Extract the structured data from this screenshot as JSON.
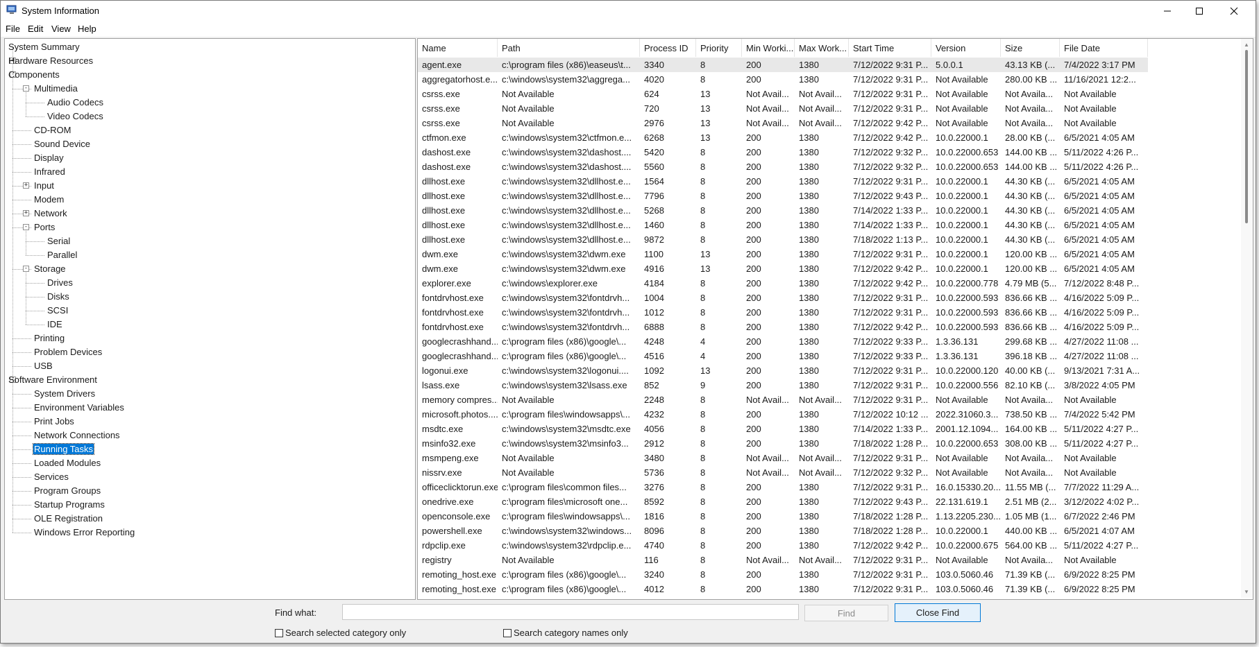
{
  "window": {
    "title": "System Information"
  },
  "menu": [
    "File",
    "Edit",
    "View",
    "Help"
  ],
  "tree": [
    {
      "label": "System Summary",
      "level": 0,
      "expander": ""
    },
    {
      "label": "Hardware Resources",
      "level": 0,
      "expander": "+"
    },
    {
      "label": "Components",
      "level": 0,
      "expander": "-"
    },
    {
      "label": "Multimedia",
      "level": 1,
      "expander": "-"
    },
    {
      "label": "Audio Codecs",
      "level": 2,
      "expander": ""
    },
    {
      "label": "Video Codecs",
      "level": 2,
      "expander": ""
    },
    {
      "label": "CD-ROM",
      "level": 1,
      "expander": ""
    },
    {
      "label": "Sound Device",
      "level": 1,
      "expander": ""
    },
    {
      "label": "Display",
      "level": 1,
      "expander": ""
    },
    {
      "label": "Infrared",
      "level": 1,
      "expander": ""
    },
    {
      "label": "Input",
      "level": 1,
      "expander": "+"
    },
    {
      "label": "Modem",
      "level": 1,
      "expander": ""
    },
    {
      "label": "Network",
      "level": 1,
      "expander": "+"
    },
    {
      "label": "Ports",
      "level": 1,
      "expander": "-"
    },
    {
      "label": "Serial",
      "level": 2,
      "expander": ""
    },
    {
      "label": "Parallel",
      "level": 2,
      "expander": ""
    },
    {
      "label": "Storage",
      "level": 1,
      "expander": "-"
    },
    {
      "label": "Drives",
      "level": 2,
      "expander": ""
    },
    {
      "label": "Disks",
      "level": 2,
      "expander": ""
    },
    {
      "label": "SCSI",
      "level": 2,
      "expander": ""
    },
    {
      "label": "IDE",
      "level": 2,
      "expander": ""
    },
    {
      "label": "Printing",
      "level": 1,
      "expander": ""
    },
    {
      "label": "Problem Devices",
      "level": 1,
      "expander": ""
    },
    {
      "label": "USB",
      "level": 1,
      "expander": ""
    },
    {
      "label": "Software Environment",
      "level": 0,
      "expander": "-"
    },
    {
      "label": "System Drivers",
      "level": 1,
      "expander": ""
    },
    {
      "label": "Environment Variables",
      "level": 1,
      "expander": ""
    },
    {
      "label": "Print Jobs",
      "level": 1,
      "expander": ""
    },
    {
      "label": "Network Connections",
      "level": 1,
      "expander": ""
    },
    {
      "label": "Running Tasks",
      "level": 1,
      "expander": "",
      "selected": true
    },
    {
      "label": "Loaded Modules",
      "level": 1,
      "expander": ""
    },
    {
      "label": "Services",
      "level": 1,
      "expander": ""
    },
    {
      "label": "Program Groups",
      "level": 1,
      "expander": ""
    },
    {
      "label": "Startup Programs",
      "level": 1,
      "expander": ""
    },
    {
      "label": "OLE Registration",
      "level": 1,
      "expander": ""
    },
    {
      "label": "Windows Error Reporting",
      "level": 1,
      "expander": ""
    }
  ],
  "columns": [
    "Name",
    "Path",
    "Process ID",
    "Priority",
    "Min Worki...",
    "Max Work...",
    "Start Time",
    "Version",
    "Size",
    "File Date"
  ],
  "rows": [
    [
      "agent.exe",
      "c:\\program files (x86)\\easeus\\t...",
      "3340",
      "8",
      "200",
      "1380",
      "7/12/2022 9:31 P...",
      "5.0.0.1",
      "43.13 KB (...",
      "7/4/2022 3:17 PM"
    ],
    [
      "aggregatorhost.e...",
      "c:\\windows\\system32\\aggrega...",
      "4020",
      "8",
      "200",
      "1380",
      "7/12/2022 9:31 P...",
      "Not Available",
      "280.00 KB ...",
      "11/16/2021 12:2..."
    ],
    [
      "csrss.exe",
      "Not Available",
      "624",
      "13",
      "Not Avail...",
      "Not Avail...",
      "7/12/2022 9:31 P...",
      "Not Available",
      "Not Availa...",
      "Not Available"
    ],
    [
      "csrss.exe",
      "Not Available",
      "720",
      "13",
      "Not Avail...",
      "Not Avail...",
      "7/12/2022 9:31 P...",
      "Not Available",
      "Not Availa...",
      "Not Available"
    ],
    [
      "csrss.exe",
      "Not Available",
      "2976",
      "13",
      "Not Avail...",
      "Not Avail...",
      "7/12/2022 9:42 P...",
      "Not Available",
      "Not Availa...",
      "Not Available"
    ],
    [
      "ctfmon.exe",
      "c:\\windows\\system32\\ctfmon.e...",
      "6268",
      "13",
      "200",
      "1380",
      "7/12/2022 9:42 P...",
      "10.0.22000.1",
      "28.00 KB (...",
      "6/5/2021 4:05 AM"
    ],
    [
      "dashost.exe",
      "c:\\windows\\system32\\dashost....",
      "5420",
      "8",
      "200",
      "1380",
      "7/12/2022 9:32 P...",
      "10.0.22000.653",
      "144.00 KB ...",
      "5/11/2022 4:26 P..."
    ],
    [
      "dashost.exe",
      "c:\\windows\\system32\\dashost....",
      "5560",
      "8",
      "200",
      "1380",
      "7/12/2022 9:32 P...",
      "10.0.22000.653",
      "144.00 KB ...",
      "5/11/2022 4:26 P..."
    ],
    [
      "dllhost.exe",
      "c:\\windows\\system32\\dllhost.e...",
      "1564",
      "8",
      "200",
      "1380",
      "7/12/2022 9:31 P...",
      "10.0.22000.1",
      "44.30 KB (...",
      "6/5/2021 4:05 AM"
    ],
    [
      "dllhost.exe",
      "c:\\windows\\system32\\dllhost.e...",
      "7796",
      "8",
      "200",
      "1380",
      "7/12/2022 9:43 P...",
      "10.0.22000.1",
      "44.30 KB (...",
      "6/5/2021 4:05 AM"
    ],
    [
      "dllhost.exe",
      "c:\\windows\\system32\\dllhost.e...",
      "5268",
      "8",
      "200",
      "1380",
      "7/14/2022 1:33 P...",
      "10.0.22000.1",
      "44.30 KB (...",
      "6/5/2021 4:05 AM"
    ],
    [
      "dllhost.exe",
      "c:\\windows\\system32\\dllhost.e...",
      "1460",
      "8",
      "200",
      "1380",
      "7/14/2022 1:33 P...",
      "10.0.22000.1",
      "44.30 KB (...",
      "6/5/2021 4:05 AM"
    ],
    [
      "dllhost.exe",
      "c:\\windows\\system32\\dllhost.e...",
      "9872",
      "8",
      "200",
      "1380",
      "7/18/2022 1:13 P...",
      "10.0.22000.1",
      "44.30 KB (...",
      "6/5/2021 4:05 AM"
    ],
    [
      "dwm.exe",
      "c:\\windows\\system32\\dwm.exe",
      "1100",
      "13",
      "200",
      "1380",
      "7/12/2022 9:31 P...",
      "10.0.22000.1",
      "120.00 KB ...",
      "6/5/2021 4:05 AM"
    ],
    [
      "dwm.exe",
      "c:\\windows\\system32\\dwm.exe",
      "4916",
      "13",
      "200",
      "1380",
      "7/12/2022 9:42 P...",
      "10.0.22000.1",
      "120.00 KB ...",
      "6/5/2021 4:05 AM"
    ],
    [
      "explorer.exe",
      "c:\\windows\\explorer.exe",
      "4184",
      "8",
      "200",
      "1380",
      "7/12/2022 9:42 P...",
      "10.0.22000.778",
      "4.79 MB (5...",
      "7/12/2022 8:48 P..."
    ],
    [
      "fontdrvhost.exe",
      "c:\\windows\\system32\\fontdrvh...",
      "1004",
      "8",
      "200",
      "1380",
      "7/12/2022 9:31 P...",
      "10.0.22000.593",
      "836.66 KB ...",
      "4/16/2022 5:09 P..."
    ],
    [
      "fontdrvhost.exe",
      "c:\\windows\\system32\\fontdrvh...",
      "1012",
      "8",
      "200",
      "1380",
      "7/12/2022 9:31 P...",
      "10.0.22000.593",
      "836.66 KB ...",
      "4/16/2022 5:09 P..."
    ],
    [
      "fontdrvhost.exe",
      "c:\\windows\\system32\\fontdrvh...",
      "6888",
      "8",
      "200",
      "1380",
      "7/12/2022 9:42 P...",
      "10.0.22000.593",
      "836.66 KB ...",
      "4/16/2022 5:09 P..."
    ],
    [
      "googlecrashhand...",
      "c:\\program files (x86)\\google\\...",
      "4248",
      "4",
      "200",
      "1380",
      "7/12/2022 9:33 P...",
      "1.3.36.131",
      "299.68 KB ...",
      "4/27/2022 11:08 ..."
    ],
    [
      "googlecrashhand...",
      "c:\\program files (x86)\\google\\...",
      "4516",
      "4",
      "200",
      "1380",
      "7/12/2022 9:33 P...",
      "1.3.36.131",
      "396.18 KB ...",
      "4/27/2022 11:08 ..."
    ],
    [
      "logonui.exe",
      "c:\\windows\\system32\\logonui....",
      "1092",
      "13",
      "200",
      "1380",
      "7/12/2022 9:31 P...",
      "10.0.22000.120",
      "40.00 KB (...",
      "9/13/2021 7:31 A..."
    ],
    [
      "lsass.exe",
      "c:\\windows\\system32\\lsass.exe",
      "852",
      "9",
      "200",
      "1380",
      "7/12/2022 9:31 P...",
      "10.0.22000.556",
      "82.10 KB (...",
      "3/8/2022 4:05 PM"
    ],
    [
      "memory compres...",
      "Not Available",
      "2248",
      "8",
      "Not Avail...",
      "Not Avail...",
      "7/12/2022 9:31 P...",
      "Not Available",
      "Not Availa...",
      "Not Available"
    ],
    [
      "microsoft.photos....",
      "c:\\program files\\windowsapps\\...",
      "4232",
      "8",
      "200",
      "1380",
      "7/12/2022 10:12 ...",
      "2022.31060.3...",
      "738.50 KB ...",
      "7/4/2022 5:42 PM"
    ],
    [
      "msdtc.exe",
      "c:\\windows\\system32\\msdtc.exe",
      "4056",
      "8",
      "200",
      "1380",
      "7/14/2022 1:33 P...",
      "2001.12.1094...",
      "164.00 KB ...",
      "5/11/2022 4:27 P..."
    ],
    [
      "msinfo32.exe",
      "c:\\windows\\system32\\msinfo3...",
      "2912",
      "8",
      "200",
      "1380",
      "7/18/2022 1:28 P...",
      "10.0.22000.653",
      "308.00 KB ...",
      "5/11/2022 4:27 P..."
    ],
    [
      "msmpeng.exe",
      "Not Available",
      "3480",
      "8",
      "Not Avail...",
      "Not Avail...",
      "7/12/2022 9:31 P...",
      "Not Available",
      "Not Availa...",
      "Not Available"
    ],
    [
      "nissrv.exe",
      "Not Available",
      "5736",
      "8",
      "Not Avail...",
      "Not Avail...",
      "7/12/2022 9:32 P...",
      "Not Available",
      "Not Availa...",
      "Not Available"
    ],
    [
      "officeclicktorun.exe",
      "c:\\program files\\common files...",
      "3276",
      "8",
      "200",
      "1380",
      "7/12/2022 9:31 P...",
      "16.0.15330.20...",
      "11.55 MB (...",
      "7/7/2022 11:29 A..."
    ],
    [
      "onedrive.exe",
      "c:\\program files\\microsoft one...",
      "8592",
      "8",
      "200",
      "1380",
      "7/12/2022 9:43 P...",
      "22.131.619.1",
      "2.51 MB (2...",
      "3/12/2022 4:02 P..."
    ],
    [
      "openconsole.exe",
      "c:\\program files\\windowsapps\\...",
      "1816",
      "8",
      "200",
      "1380",
      "7/18/2022 1:28 P...",
      "1.13.2205.230...",
      "1.05 MB (1...",
      "6/7/2022 2:46 PM"
    ],
    [
      "powershell.exe",
      "c:\\windows\\system32\\windows...",
      "8096",
      "8",
      "200",
      "1380",
      "7/18/2022 1:28 P...",
      "10.0.22000.1",
      "440.00 KB ...",
      "6/5/2021 4:07 AM"
    ],
    [
      "rdpclip.exe",
      "c:\\windows\\system32\\rdpclip.e...",
      "4740",
      "8",
      "200",
      "1380",
      "7/12/2022 9:42 P...",
      "10.0.22000.675",
      "564.00 KB ...",
      "5/11/2022 4:27 P..."
    ],
    [
      "registry",
      "Not Available",
      "116",
      "8",
      "Not Avail...",
      "Not Avail...",
      "7/12/2022 9:31 P...",
      "Not Available",
      "Not Availa...",
      "Not Available"
    ],
    [
      "remoting_host.exe",
      "c:\\program files (x86)\\google\\...",
      "3240",
      "8",
      "200",
      "1380",
      "7/12/2022 9:31 P...",
      "103.0.5060.46",
      "71.39 KB (...",
      "6/9/2022 8:25 PM"
    ],
    [
      "remoting_host.exe",
      "c:\\program files (x86)\\google\\...",
      "4012",
      "8",
      "200",
      "1380",
      "7/12/2022 9:31 P...",
      "103.0.5060.46",
      "71.39 KB (...",
      "6/9/2022 8:25 PM"
    ]
  ],
  "find": {
    "label": "Find what:",
    "value": "",
    "find_button": "Find",
    "close_find_button": "Close Find",
    "checkbox_selected": "Search selected category only",
    "checkbox_names": "Search category names only"
  },
  "colors": {
    "selection": "#0078d7",
    "hover_row": "#e8e8e8"
  }
}
